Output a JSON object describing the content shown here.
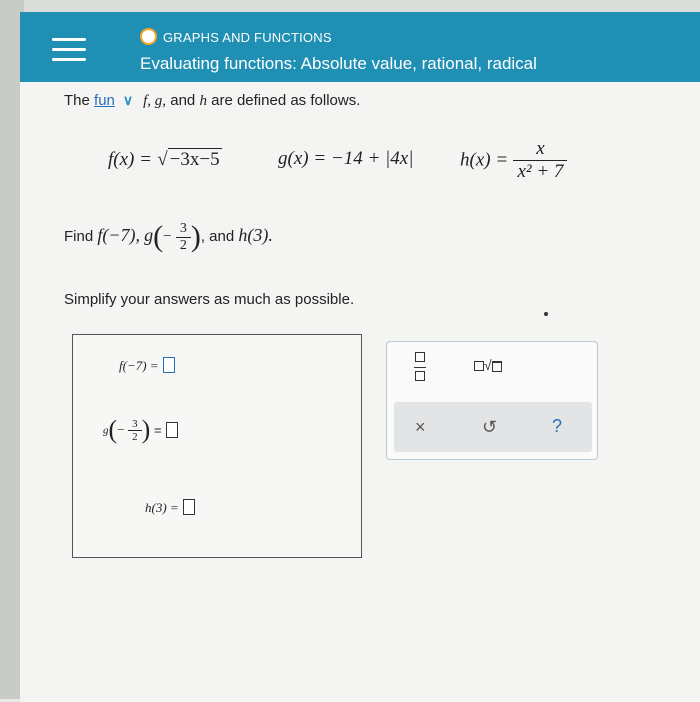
{
  "header": {
    "section_label": "GRAPHS AND FUNCTIONS",
    "title": "Evaluating functions: Absolute value, rational, radical"
  },
  "problem": {
    "intro_prefix": "The",
    "intro_link": "fun",
    "intro_rest": "are defined as follows.",
    "funcs": "f, g,",
    "and_word": "and",
    "h": "h",
    "f_lhs": "f(x) =",
    "f_radicand": "−3x−5",
    "g_def": "g(x) = −14 + |4x|",
    "h_lhs": "h(x) =",
    "h_num": "x",
    "h_den": "x² + 7",
    "find_label": "Find",
    "find_f": "f(−7),",
    "find_g": "g",
    "minus": "−",
    "num3": "3",
    "den2": "2",
    "find_and": ", and",
    "find_h": "h(3).",
    "simplify": "Simplify your answers as much as possible."
  },
  "answers": {
    "f_label": "f(−7) =",
    "g_label": "g",
    "g_minus": "−",
    "g_num": "3",
    "g_den": "2",
    "g_eq": "=",
    "h_label": "h(3) ="
  },
  "tools": {
    "clear": "×",
    "undo": "↺",
    "help": "?"
  },
  "colors": {
    "header_bg": "#1f8fb3",
    "accent_dot": "#f5a623",
    "link": "#2a6fb5"
  }
}
